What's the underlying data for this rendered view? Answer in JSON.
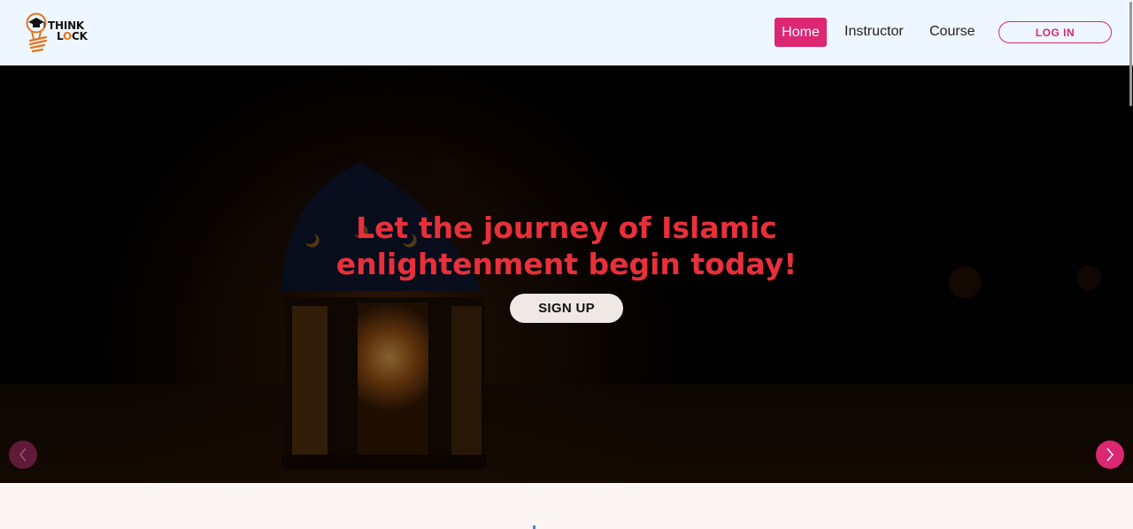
{
  "header": {
    "logo": {
      "line1": "THINK",
      "line2_a": "L",
      "line2_o": "O",
      "line2_b": "CK",
      "icon": "lightbulb-graduation-cap-icon"
    },
    "nav": {
      "home": "Home",
      "instructor": "Instructor",
      "course": "Course",
      "login": "LOG IN"
    },
    "colors": {
      "accent": "#dc2773",
      "header_bg": "#eef6ff"
    }
  },
  "hero": {
    "title": "Let the journey of Islamic enlightenment begin today!",
    "signup": "SIGN UP",
    "title_color": "#e8303a",
    "prev_icon": "chevron-left-icon",
    "next_icon": "chevron-right-icon"
  }
}
